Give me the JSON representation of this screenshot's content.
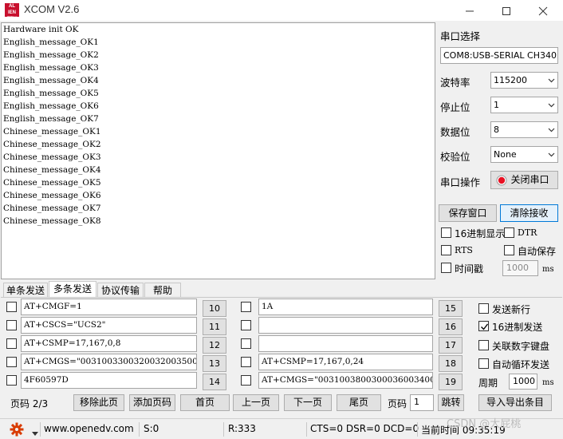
{
  "window": {
    "logo_text": "ALIENTEK",
    "title": "XCOM V2.6"
  },
  "receive": {
    "lines": [
      "Hardware init OK",
      "English_message_OK1",
      "English_message_OK2",
      "English_message_OK3",
      "English_message_OK4",
      "English_message_OK5",
      "English_message_OK6",
      "English_message_OK7",
      "Chinese_message_OK1",
      "Chinese_message_OK2",
      "Chinese_message_OK3",
      "Chinese_message_OK4",
      "Chinese_message_OK5",
      "Chinese_message_OK6",
      "Chinese_message_OK7",
      "Chinese_message_OK8"
    ]
  },
  "serial": {
    "port_label": "串口选择",
    "port_value": "COM8:USB-SERIAL CH340",
    "baud_label": "波特率",
    "baud_value": "115200",
    "stop_label": "停止位",
    "stop_value": "1",
    "data_label": "数据位",
    "data_value": "8",
    "parity_label": "校验位",
    "parity_value": "None",
    "op_label": "串口操作",
    "op_button": "关闭串口",
    "save_window": "保存窗口",
    "clear_recv": "清除接收",
    "hex_display": "16进制显示",
    "dtr": "DTR",
    "rts": "RTS",
    "auto_save": "自动保存",
    "timestamp": "时间戳",
    "timestamp_value": "1000",
    "timestamp_unit": "ms",
    "status_color": "#e81123"
  },
  "tabs": [
    "单条发送",
    "多条发送",
    "协议传输",
    "帮助"
  ],
  "multi": {
    "left_rows": [
      {
        "text": "AT+CMGF=1",
        "num": "10"
      },
      {
        "text": "AT+CSCS=\"UCS2\"",
        "num": "11"
      },
      {
        "text": "AT+CSMP=17,167,0,8",
        "num": "12"
      },
      {
        "text": "AT+CMGS=\"00310033003200320035003500",
        "num": "13"
      },
      {
        "text": "4F60597D",
        "num": "14"
      }
    ],
    "right_rows": [
      {
        "text": "1A",
        "num": "15"
      },
      {
        "text": "",
        "num": "16"
      },
      {
        "text": "",
        "num": "17"
      },
      {
        "text": "AT+CSMP=17,167,0,24",
        "num": "18"
      },
      {
        "text": "AT+CMGS=\"003100380030003600340031003",
        "num": "19"
      }
    ],
    "send_newline": "发送新行",
    "hex_send": "16进制发送",
    "link_keyboard": "关联数字键盘",
    "auto_loop": "自动循环发送",
    "period_label": "周期",
    "period_value": "1000",
    "period_unit": "ms",
    "page_info": "页码 2/3",
    "remove_page": "移除此页",
    "add_page": "添加页码",
    "first": "首页",
    "prev": "上一页",
    "next": "下一页",
    "last": "尾页",
    "page_label": "页码",
    "page_value": "1",
    "jump": "跳转",
    "import_export": "导入导出条目"
  },
  "statusbar": {
    "url": "www.openedv.com",
    "sent": "S:0",
    "received": "R:333",
    "lines": "CTS=0 DSR=0 DCD=0",
    "time": "当前时间 09:35:19",
    "watermark": "CSDN @大屁桃"
  }
}
